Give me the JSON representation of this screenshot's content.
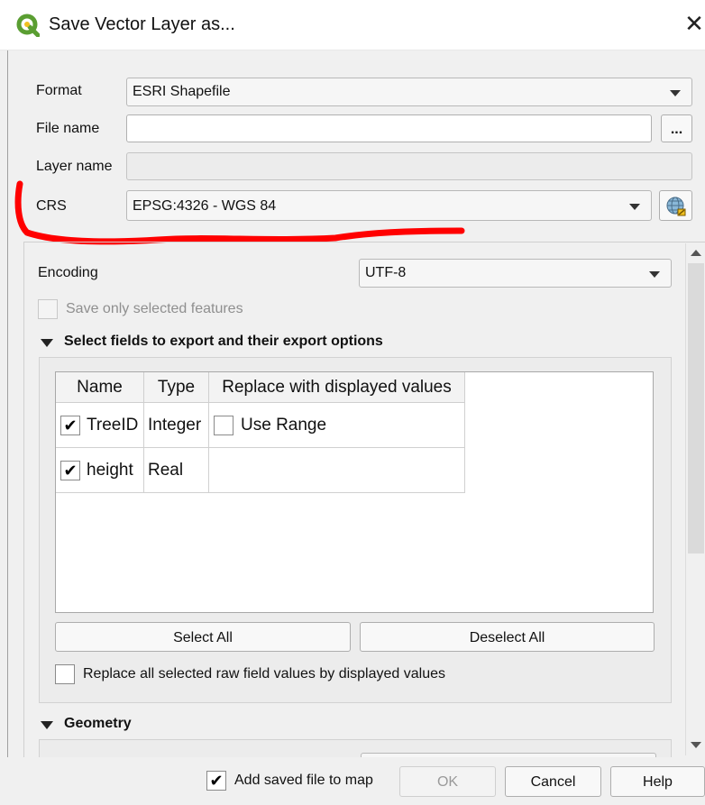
{
  "window": {
    "title": "Save Vector Layer as...",
    "close_glyph": "✕"
  },
  "form": {
    "format_label": "Format",
    "format_value": "ESRI Shapefile",
    "file_name_label": "File name",
    "file_name_value": "",
    "browse_label": "...",
    "layer_name_label": "Layer name",
    "crs_label": "CRS",
    "crs_value": "EPSG:4326 - WGS 84"
  },
  "options": {
    "encoding_label": "Encoding",
    "encoding_value": "UTF-8",
    "save_selected_label": "Save only selected features",
    "save_selected_checked": false
  },
  "fields_section": {
    "title": "Select fields to export and their export options",
    "columns": [
      "Name",
      "Type",
      "Replace with displayed values"
    ],
    "rows": [
      {
        "checked": true,
        "name": "TreeID",
        "type": "Integer",
        "replace_checked": false,
        "replace_label": "Use Range"
      },
      {
        "checked": true,
        "name": "height",
        "type": "Real",
        "replace_label": ""
      }
    ],
    "select_all_label": "Select All",
    "deselect_all_label": "Deselect All",
    "replace_all_label": "Replace all selected raw field values by displayed values"
  },
  "geometry_section": {
    "title": "Geometry"
  },
  "footer": {
    "add_to_map_label": "Add saved file to map",
    "add_to_map_checked": true,
    "ok_label": "OK",
    "cancel_label": "Cancel",
    "help_label": "Help"
  },
  "icons": {
    "app": "qgis-logo-icon",
    "crs_select": "globe-projection-icon",
    "check": "✔"
  },
  "colors": {
    "annotation": "#ff0000",
    "qgis_green": "#5a9e32",
    "qgis_yellow": "#f0c020"
  }
}
